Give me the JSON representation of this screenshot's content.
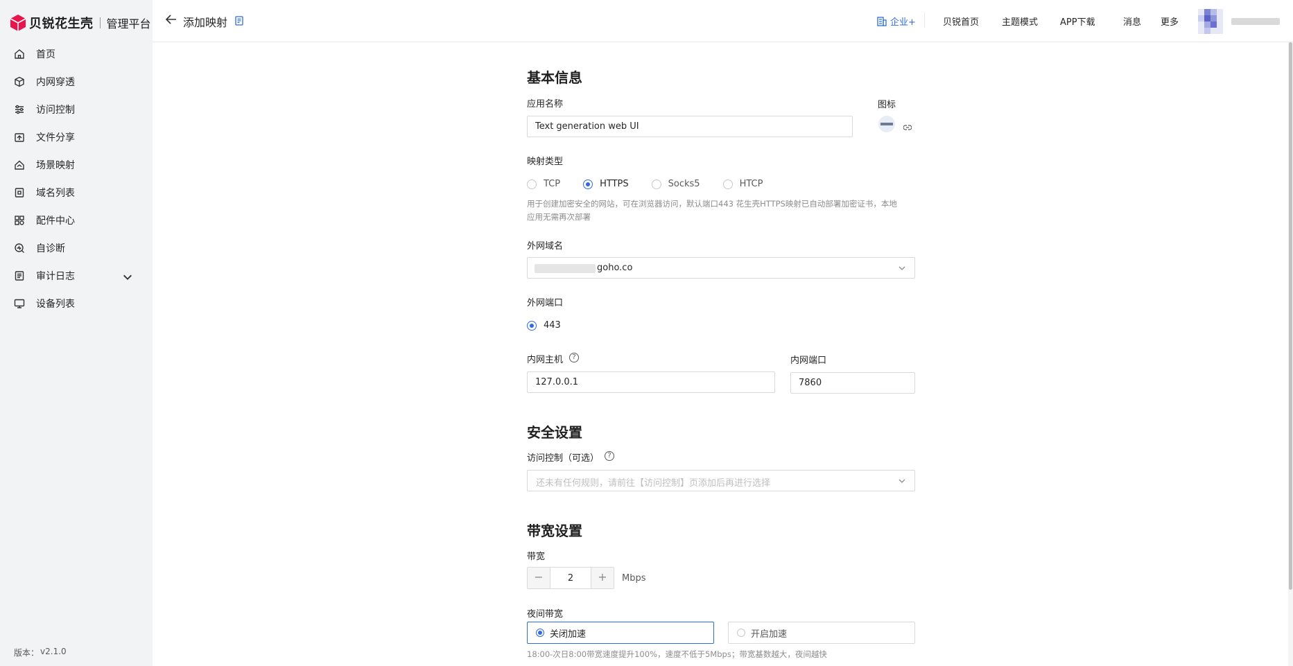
{
  "brand": {
    "name": "贝锐花生壳",
    "subtitle": "管理平台",
    "accent": "#e8164c"
  },
  "sidebar": {
    "items": [
      {
        "label": "首页",
        "icon": "home-icon"
      },
      {
        "label": "内网穿透",
        "icon": "cube-icon"
      },
      {
        "label": "访问控制",
        "icon": "sliders-icon"
      },
      {
        "label": "文件分享",
        "icon": "share-icon"
      },
      {
        "label": "场景映射",
        "icon": "house-icon"
      },
      {
        "label": "域名列表",
        "icon": "domain-icon"
      },
      {
        "label": "配件中心",
        "icon": "grid-icon"
      },
      {
        "label": "自诊断",
        "icon": "diagnose-icon"
      },
      {
        "label": "审计日志",
        "icon": "log-icon"
      },
      {
        "label": "设备列表",
        "icon": "monitor-icon"
      }
    ],
    "version_label": "版本：",
    "version": "v2.1.0"
  },
  "header": {
    "title": "添加映射",
    "nav": [
      "企业+",
      "贝锐首页",
      "主题模式",
      "APP下载",
      "消息",
      "更多"
    ]
  },
  "form": {
    "basic": {
      "title": "基本信息",
      "app_name_label": "应用名称",
      "app_name_value": "Text generation web UI",
      "icon_label": "图标",
      "type_label": "映射类型",
      "types": [
        "TCP",
        "HTTPS",
        "Socks5",
        "HTCP"
      ],
      "selected_type": "HTTPS",
      "type_desc_line1": "用于创建加密安全的网站，可在浏览器访问，默认端口443 花生壳HTTPS映射已自动部署加密证书，本地",
      "type_desc_line2": "应用无需再次部署",
      "domain_label": "外网域名",
      "domain_value": "goho.co",
      "port_label": "外网端口",
      "port_value": "443",
      "host_label": "内网主机",
      "host_value": "127.0.0.1",
      "inner_port_label": "内网端口",
      "inner_port_value": "7860"
    },
    "security": {
      "title": "安全设置",
      "access_label": "访问控制（可选）",
      "access_placeholder": "还未有任何规则，请前往【访问控制】页添加后再进行选择"
    },
    "bandwidth": {
      "title": "带宽设置",
      "bw_label": "带宽",
      "bw_value": "2",
      "bw_unit": "Mbps",
      "night_label": "夜间带宽",
      "night_off": "关闭加速",
      "night_on": "开启加速",
      "night_selected": "关闭加速",
      "night_desc": "18:00-次日8:00带宽速度提升100%，速度不低于5Mbps；带宽基数越大，夜间越快"
    }
  },
  "colors": {
    "primary": "#2f6bde",
    "sidebar_bg": "#f2f3f5"
  }
}
